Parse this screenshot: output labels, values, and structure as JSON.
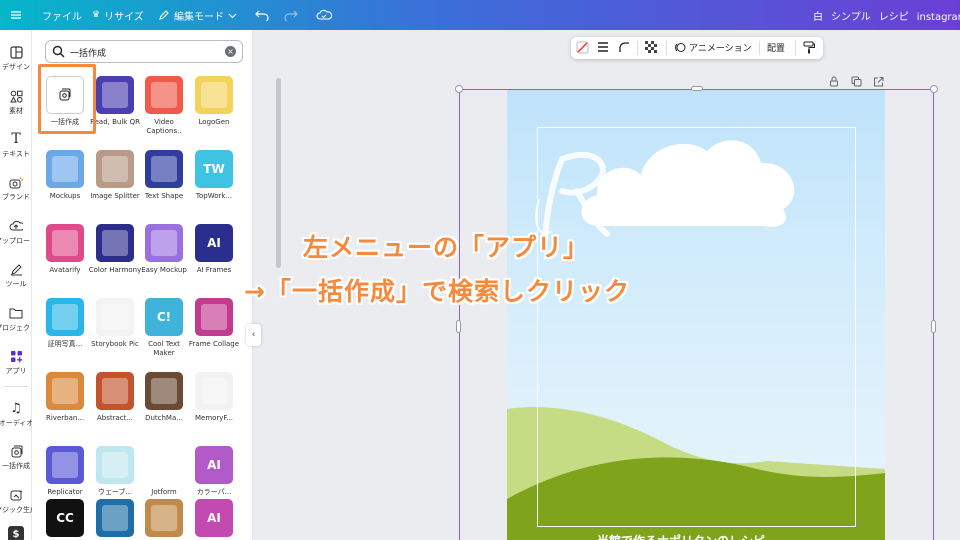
{
  "topbar": {
    "file_label": "ファイル",
    "resize_label": "リサイズ",
    "edit_mode_label": "編集モード",
    "right_items": [
      "白",
      "シンプル",
      "レシピ",
      "instagram投稿"
    ]
  },
  "rail": {
    "items": [
      {
        "label": "デザイン",
        "icon": "layout-icon"
      },
      {
        "label": "素材",
        "icon": "elements-icon"
      },
      {
        "label": "テキスト",
        "icon": "text-icon"
      },
      {
        "label": "ブランド",
        "icon": "brand-icon"
      },
      {
        "label": "アップロード",
        "icon": "upload-icon"
      },
      {
        "label": "ツール",
        "icon": "pen-tool-icon"
      },
      {
        "label": "プロジェクト",
        "icon": "folder-icon"
      },
      {
        "label": "アプリ",
        "icon": "apps-icon"
      },
      {
        "label": "オーディオ",
        "icon": "music-icon"
      },
      {
        "label": "一括作成",
        "icon": "bulk-create-icon"
      },
      {
        "label": "マジック生成",
        "icon": "magic-icon"
      },
      {
        "label": "",
        "icon": "dollar-icon"
      }
    ]
  },
  "search": {
    "value": "一括作成"
  },
  "apps": [
    {
      "name": "一括作成",
      "color": "#ffffff"
    },
    {
      "name": "Read, Bulk QR",
      "color": "#4a3fb0"
    },
    {
      "name": "Video Captions..",
      "color": "#f05a4a"
    },
    {
      "name": "LogoGen",
      "color": "#f3d35c"
    },
    {
      "name": "Mockups",
      "color": "#6aa8e8"
    },
    {
      "name": "Image Splitter",
      "color": "#b89a86"
    },
    {
      "name": "Text Shape",
      "color": "#2f3d9e"
    },
    {
      "name": "TopWork...",
      "color": "#3fc3e3",
      "tile_text": "TW"
    },
    {
      "name": "Avatarify",
      "color": "#e04a8a"
    },
    {
      "name": "Color Harmony",
      "color": "#2c2c8c"
    },
    {
      "name": "Easy Mockup",
      "color": "#9a6fe0"
    },
    {
      "name": "AI Frames",
      "color": "#2a2f8f",
      "tile_text": "AI"
    },
    {
      "name": "証明写真...",
      "color": "#29b6e8"
    },
    {
      "name": "Storybook Pic",
      "color": "#f3f3f3"
    },
    {
      "name": "Cool Text Maker",
      "color": "#3fb3d9",
      "tile_text": "C!"
    },
    {
      "name": "Frame Collage",
      "color": "#c23b8f"
    },
    {
      "name": "Riverban...",
      "color": "#d98a3c"
    },
    {
      "name": "Abstract...",
      "color": "#c2532b"
    },
    {
      "name": "DutchMa...",
      "color": "#6b4a35"
    },
    {
      "name": "MemoryF...",
      "color": "#f2f2f2"
    },
    {
      "name": "Replicator",
      "color": "#5a5ad6"
    },
    {
      "name": "ウェーブ...",
      "color": "#bfe7ef"
    },
    {
      "name": "Jotform",
      "color": "#ffffff"
    },
    {
      "name": "カラーパ...",
      "color": "#b35ac9",
      "tile_text": "AI"
    },
    {
      "name": "",
      "color": "#111111",
      "tile_text": "CC"
    },
    {
      "name": "",
      "color": "#1e6fa8"
    },
    {
      "name": "",
      "color": "#c28a4a"
    },
    {
      "name": "",
      "color": "#c24ab0",
      "tile_text": "AI"
    }
  ],
  "floating_toolbar": {
    "animation_label": "アニメーション",
    "position_label": "配置"
  },
  "canvas": {
    "footer_text": "当館で作るナポリタンのレシピ"
  },
  "annotation": {
    "line1": "左メニューの「アプリ」",
    "line2": "→「一括作成」で検索しクリック"
  },
  "colors": {
    "accent": "#8b5cf6",
    "highlight": "#f58a3c"
  }
}
